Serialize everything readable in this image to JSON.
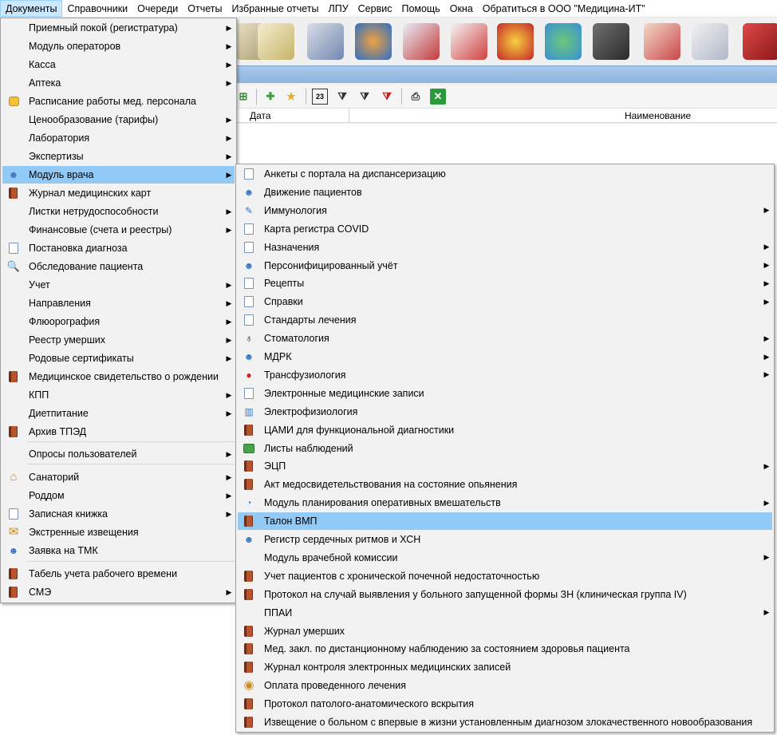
{
  "menubar": {
    "items": [
      "Документы",
      "Справочники",
      "Очереди",
      "Отчеты",
      "Избранные отчеты",
      "ЛПУ",
      "Сервис",
      "Помощь",
      "Окна",
      "Обратиться в ООО \"Медицина-ИТ\""
    ],
    "active_index": 0
  },
  "grid": {
    "col_date": "Дата",
    "col_name": "Наименование"
  },
  "documents_menu": {
    "items": [
      {
        "label": "Приемный покой (регистратура)",
        "icon": "none",
        "submenu": true
      },
      {
        "label": "Модуль операторов",
        "icon": "none",
        "submenu": true
      },
      {
        "label": "Касса",
        "icon": "none",
        "submenu": true
      },
      {
        "label": "Аптека",
        "icon": "none",
        "submenu": true
      },
      {
        "label": "Расписание работы мед. персонала",
        "icon": "schedule-icon",
        "submenu": false
      },
      {
        "label": "Ценообразование (тарифы)",
        "icon": "none",
        "submenu": true
      },
      {
        "label": "Лаборатория",
        "icon": "none",
        "submenu": true
      },
      {
        "label": "Экспертизы",
        "icon": "none",
        "submenu": true
      },
      {
        "label": "Модуль врача",
        "icon": "doctor-icon",
        "submenu": true,
        "highlighted": true
      },
      {
        "label": "Журнал медицинских карт",
        "icon": "book-icon",
        "submenu": false
      },
      {
        "label": "Листки нетрудоспособности",
        "icon": "none",
        "submenu": true
      },
      {
        "label": "Финансовые (счета и реестры)",
        "icon": "none",
        "submenu": true
      },
      {
        "label": "Постановка диагноза",
        "icon": "diagnosis-icon",
        "submenu": false
      },
      {
        "label": "Обследование пациента",
        "icon": "magnifier-icon",
        "submenu": false
      },
      {
        "label": "Учет",
        "icon": "none",
        "submenu": true
      },
      {
        "label": "Направления",
        "icon": "none",
        "submenu": true
      },
      {
        "label": "Флюорография",
        "icon": "none",
        "submenu": true
      },
      {
        "label": "Реестр умерших",
        "icon": "none",
        "submenu": true
      },
      {
        "label": "Родовые сертификаты",
        "icon": "none",
        "submenu": true
      },
      {
        "label": "Медицинское свидетельство о рождении",
        "icon": "book-icon",
        "submenu": false
      },
      {
        "label": "КПП",
        "icon": "none",
        "submenu": true
      },
      {
        "label": "Диетпитание",
        "icon": "none",
        "submenu": true
      },
      {
        "label": "Архив ТПЭД",
        "icon": "archive-icon",
        "submenu": false
      },
      {
        "label": "Опросы пользователей",
        "icon": "none",
        "submenu": true
      },
      {
        "label": "Санаторий",
        "icon": "house-icon",
        "submenu": true
      },
      {
        "label": "Роддом",
        "icon": "none",
        "submenu": true
      },
      {
        "label": "Записная книжка",
        "icon": "notebook-icon",
        "submenu": true
      },
      {
        "label": "Экстренные извещения",
        "icon": "alert-icon",
        "submenu": false
      },
      {
        "label": "Заявка на ТМК",
        "icon": "person-icon",
        "submenu": false
      },
      {
        "label": "Табель учета рабочего времени",
        "icon": "book-icon",
        "submenu": false
      },
      {
        "label": "СМЭ",
        "icon": "book-icon",
        "submenu": true
      }
    ]
  },
  "doctor_submenu": {
    "items": [
      {
        "label": "Анкеты с портала на диспансеризацию",
        "icon": "form-check-icon",
        "submenu": false
      },
      {
        "label": "Движение пациентов",
        "icon": "patients-icon",
        "submenu": false
      },
      {
        "label": "Иммунология",
        "icon": "syringe-icon",
        "submenu": true
      },
      {
        "label": "Карта регистра COVID",
        "icon": "covid-card-icon",
        "submenu": false
      },
      {
        "label": "Назначения",
        "icon": "prescription-icon",
        "submenu": true
      },
      {
        "label": "Персонифицированный учёт",
        "icon": "doctor-icon",
        "submenu": true
      },
      {
        "label": "Рецепты",
        "icon": "recipe-icon",
        "submenu": true
      },
      {
        "label": "Справки",
        "icon": "certificate-icon",
        "submenu": true
      },
      {
        "label": "Стандарты лечения",
        "icon": "standards-icon",
        "submenu": false
      },
      {
        "label": "Стоматология",
        "icon": "tooth-icon",
        "submenu": true
      },
      {
        "label": "МДРК",
        "icon": "people-icon",
        "submenu": true
      },
      {
        "label": "Трансфузиология",
        "icon": "blood-drop-icon",
        "submenu": true
      },
      {
        "label": "Электронные медицинские записи",
        "icon": "emr-icon",
        "submenu": false
      },
      {
        "label": "Электрофизиология",
        "icon": "chart-icon",
        "submenu": false
      },
      {
        "label": "ЦАМИ для функциональной диагностики",
        "icon": "book-icon",
        "submenu": false
      },
      {
        "label": "Листы наблюдений",
        "icon": "list-green-icon",
        "submenu": false
      },
      {
        "label": "ЭЦП",
        "icon": "signature-icon",
        "submenu": true
      },
      {
        "label": "Акт медосвидетельствования на состояние опьянения",
        "icon": "book-icon",
        "submenu": false
      },
      {
        "label": "Модуль планирования оперативных вмешательств",
        "icon": "surgery-plan-icon",
        "submenu": true
      },
      {
        "label": "Талон ВМП",
        "icon": "book-icon",
        "submenu": false,
        "highlighted": true
      },
      {
        "label": "Регистр сердечных ритмов и ХСН",
        "icon": "heart-registry-icon",
        "submenu": false
      },
      {
        "label": "Модуль врачебной комиссии",
        "icon": "none",
        "submenu": true
      },
      {
        "label": "Учет пациентов с хронической почечной недостаточностью",
        "icon": "book-icon",
        "submenu": false
      },
      {
        "label": "Протокол на случай выявления у больного запущенной формы ЗН (клиническая группа IV)",
        "icon": "book-icon",
        "submenu": false
      },
      {
        "label": "ППАИ",
        "icon": "none",
        "submenu": true
      },
      {
        "label": "Журнал умерших",
        "icon": "book-icon",
        "submenu": false
      },
      {
        "label": "Мед. закл. по дистанционному наблюдению за состоянием здоровья пациента",
        "icon": "book-icon",
        "submenu": false
      },
      {
        "label": "Журнал контроля электронных медицинских записей",
        "icon": "book-icon",
        "submenu": false
      },
      {
        "label": "Оплата проведенного лечения",
        "icon": "coins-icon",
        "submenu": false
      },
      {
        "label": "Протокол патолого-анатомического вскрытия",
        "icon": "book-icon",
        "submenu": false
      },
      {
        "label": "Извещение о больном с впервые в жизни установленным диагнозом злокачественного новообразования",
        "icon": "book-icon",
        "submenu": false
      }
    ]
  },
  "colors": {
    "menu_bg": "#f2f2f2",
    "menu_highlight": "#91c9f7",
    "menubar_active": "#cce8ff",
    "toolbar_strip": "#9cc0e6"
  }
}
